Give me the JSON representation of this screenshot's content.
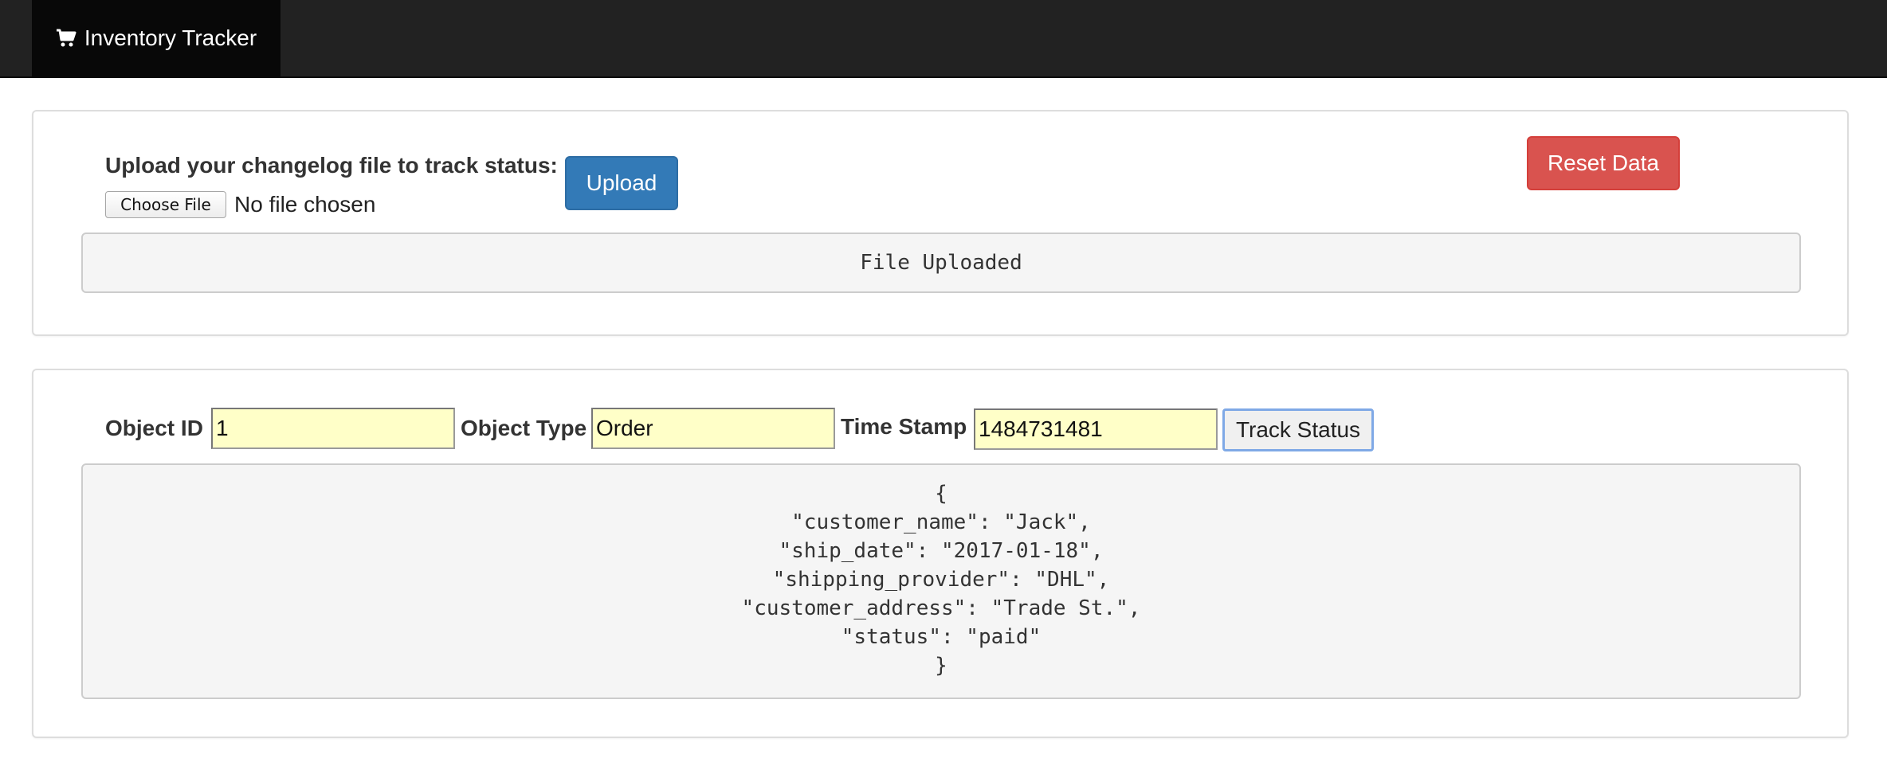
{
  "navbar": {
    "brand_label": "Inventory Tracker",
    "brand_icon": "shopping-cart-icon",
    "background": "#222222"
  },
  "upload_panel": {
    "label": "Upload your changelog file to track status:",
    "choose_file_label": "Choose File",
    "no_file_text": "No file chosen",
    "upload_button_label": "Upload",
    "reset_button_label": "Reset Data",
    "status_message": "File Uploaded"
  },
  "track_panel": {
    "object_id_label": "Object ID",
    "object_id_value": "1",
    "object_type_label": "Object Type",
    "object_type_value": "Order",
    "timestamp_label": "Time Stamp",
    "timestamp_value": "1484731481",
    "track_button_label": "Track Status",
    "result_json": "{\n\"customer_name\": \"Jack\",\n\"ship_date\": \"2017-01-18\",\n\"shipping_provider\": \"DHL\",\n\"customer_address\": \"Trade St.\",\n\"status\": \"paid\"\n}"
  },
  "colors": {
    "primary": "#337ab7",
    "danger": "#d9534f",
    "input_highlight": "#ffffc8"
  }
}
